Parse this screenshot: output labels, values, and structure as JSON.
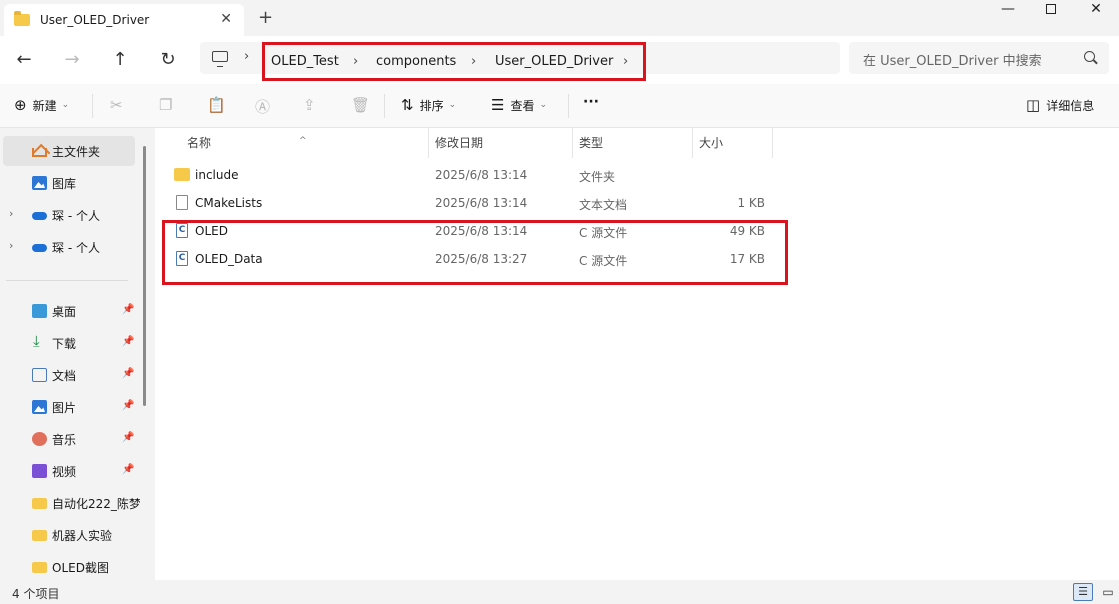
{
  "window": {
    "tab_title": "User_OLED_Driver",
    "tab_close": "✕",
    "new_tab": "+",
    "minimize": "—",
    "close": "✕"
  },
  "nav": {
    "back": "←",
    "forward": "→",
    "up": "↑",
    "refresh": "↻",
    "breadcrumbs": [
      "OLED_Test",
      "components",
      "User_OLED_Driver"
    ],
    "separator": "›",
    "search_placeholder": "在 User_OLED_Driver 中搜索"
  },
  "toolbar": {
    "new": "新建",
    "sort": "排序",
    "view": "查看",
    "more": "···",
    "details": "详细信息",
    "caret": "⌄"
  },
  "sidebar": {
    "items": [
      {
        "label": "主文件夹",
        "icon": "home-icon"
      },
      {
        "label": "图库",
        "icon": "gallery-icon"
      },
      {
        "label": "琛 - 个人",
        "icon": "onedrive-icon"
      },
      {
        "label": "琛 - 个人",
        "icon": "onedrive-icon"
      },
      {
        "label": "桌面",
        "icon": "desktop-icon"
      },
      {
        "label": "下载",
        "icon": "download-icon"
      },
      {
        "label": "文档",
        "icon": "documents-icon"
      },
      {
        "label": "图片",
        "icon": "pictures-icon"
      },
      {
        "label": "音乐",
        "icon": "music-icon"
      },
      {
        "label": "视频",
        "icon": "videos-icon"
      },
      {
        "label": "自动化222_陈梦",
        "icon": "folder-icon"
      },
      {
        "label": "机器人实验",
        "icon": "folder-icon"
      },
      {
        "label": "OLED截图",
        "icon": "folder-icon"
      }
    ],
    "pin": "📌",
    "expand": "›",
    "download_glyph": "⤓"
  },
  "columns": {
    "name": "名称",
    "date": "修改日期",
    "type": "类型",
    "size": "大小",
    "sort_indicator": "^"
  },
  "files": [
    {
      "name": "include",
      "date": "2025/6/8 13:14",
      "type": "文件夹",
      "size": "",
      "icon": "folder-icon"
    },
    {
      "name": "CMakeLists",
      "date": "2025/6/8 13:14",
      "type": "文本文档",
      "size": "1 KB",
      "icon": "text-file-icon"
    },
    {
      "name": "OLED",
      "date": "2025/6/8 13:14",
      "type": "C 源文件",
      "size": "49 KB",
      "icon": "c-file-icon"
    },
    {
      "name": "OLED_Data",
      "date": "2025/6/8 13:27",
      "type": "C 源文件",
      "size": "17 KB",
      "icon": "c-file-icon"
    }
  ],
  "file_icon_letter": "C",
  "status": {
    "item_count": "4 个项目"
  },
  "colors": {
    "highlight_red": "#d9141f",
    "folder_yellow": "#f6c94a",
    "accent_blue": "#1d6fd8"
  }
}
